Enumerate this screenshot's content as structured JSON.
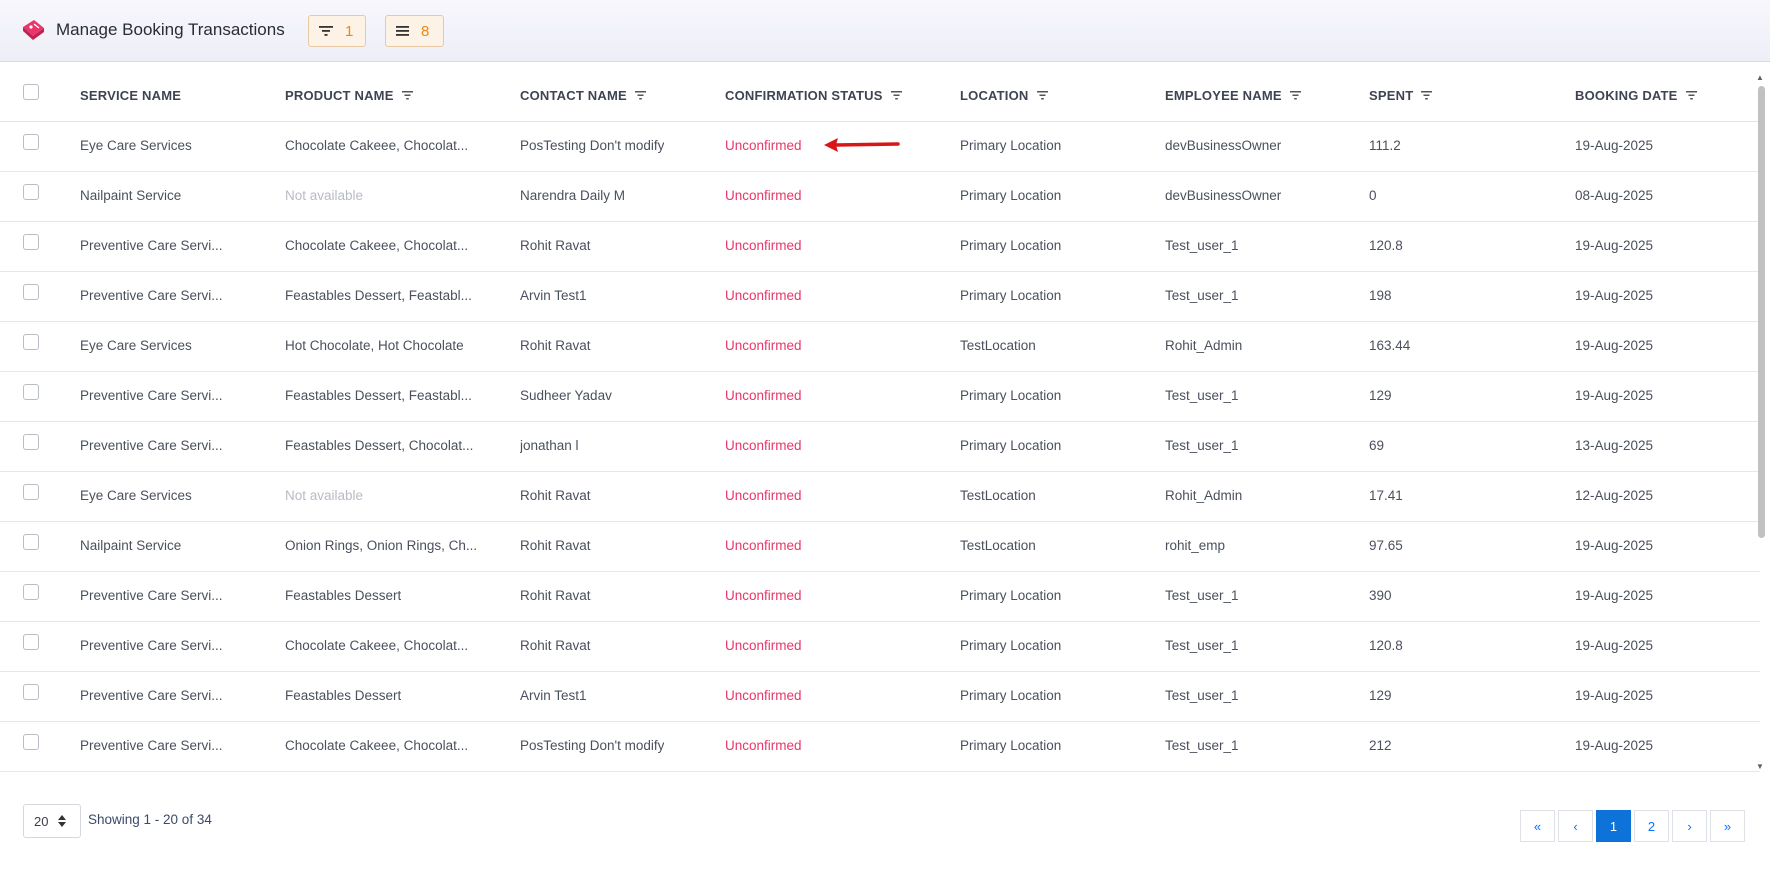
{
  "header": {
    "title": "Manage Booking Transactions",
    "filter_count": "1",
    "columns_count": "8",
    "accent_color": "#e8366a",
    "chip_color": "#e98a15"
  },
  "table": {
    "columns": [
      "SERVICE NAME",
      "PRODUCT NAME",
      "CONTACT NAME",
      "CONFIRMATION STATUS",
      "LOCATION",
      "EMPLOYEE NAME",
      "SPENT",
      "BOOKING DATE"
    ],
    "rows": [
      [
        "Eye Care Services",
        "Chocolate Cakeee, Chocolat...",
        "PosTesting Don't modify",
        "Unconfirmed",
        "Primary Location",
        "devBusinessOwner",
        "111.2",
        "19-Aug-2025"
      ],
      [
        "Nailpaint Service",
        "Not available",
        "Narendra Daily M",
        "Unconfirmed",
        "Primary Location",
        "devBusinessOwner",
        "0",
        "08-Aug-2025"
      ],
      [
        "Preventive Care Servi...",
        "Chocolate Cakeee, Chocolat...",
        "Rohit Ravat",
        "Unconfirmed",
        "Primary Location",
        "Test_user_1",
        "120.8",
        "19-Aug-2025"
      ],
      [
        "Preventive Care Servi...",
        "Feastables Dessert, Feastabl...",
        "Arvin Test1",
        "Unconfirmed",
        "Primary Location",
        "Test_user_1",
        "198",
        "19-Aug-2025"
      ],
      [
        "Eye Care Services",
        "Hot Chocolate, Hot Chocolate",
        "Rohit Ravat",
        "Unconfirmed",
        "TestLocation",
        "Rohit_Admin",
        "163.44",
        "19-Aug-2025"
      ],
      [
        "Preventive Care Servi...",
        "Feastables Dessert, Feastabl...",
        "Sudheer Yadav",
        "Unconfirmed",
        "Primary Location",
        "Test_user_1",
        "129",
        "19-Aug-2025"
      ],
      [
        "Preventive Care Servi...",
        "Feastables Dessert, Chocolat...",
        "jonathan l",
        "Unconfirmed",
        "Primary Location",
        "Test_user_1",
        "69",
        "13-Aug-2025"
      ],
      [
        "Eye Care Services",
        "Not available",
        "Rohit Ravat",
        "Unconfirmed",
        "TestLocation",
        "Rohit_Admin",
        "17.41",
        "12-Aug-2025"
      ],
      [
        "Nailpaint Service",
        "Onion Rings, Onion Rings, Ch...",
        "Rohit Ravat",
        "Unconfirmed",
        "TestLocation",
        "rohit_emp",
        "97.65",
        "19-Aug-2025"
      ],
      [
        "Preventive Care Servi...",
        "Feastables Dessert",
        "Rohit Ravat",
        "Unconfirmed",
        "Primary Location",
        "Test_user_1",
        "390",
        "19-Aug-2025"
      ],
      [
        "Preventive Care Servi...",
        "Chocolate Cakeee, Chocolat...",
        "Rohit Ravat",
        "Unconfirmed",
        "Primary Location",
        "Test_user_1",
        "120.8",
        "19-Aug-2025"
      ],
      [
        "Preventive Care Servi...",
        "Feastables Dessert",
        "Arvin Test1",
        "Unconfirmed",
        "Primary Location",
        "Test_user_1",
        "129",
        "19-Aug-2025"
      ],
      [
        "Preventive Care Servi...",
        "Chocolate Cakeee, Chocolat...",
        "PosTesting Don't modify",
        "Unconfirmed",
        "Primary Location",
        "Test_user_1",
        "212",
        "19-Aug-2025"
      ]
    ]
  },
  "footer": {
    "page_size": "20",
    "showing": "Showing 1 - 20 of 34",
    "pages": [
      "«",
      "‹",
      "1",
      "2",
      "›",
      "»"
    ],
    "active_page": "1"
  }
}
